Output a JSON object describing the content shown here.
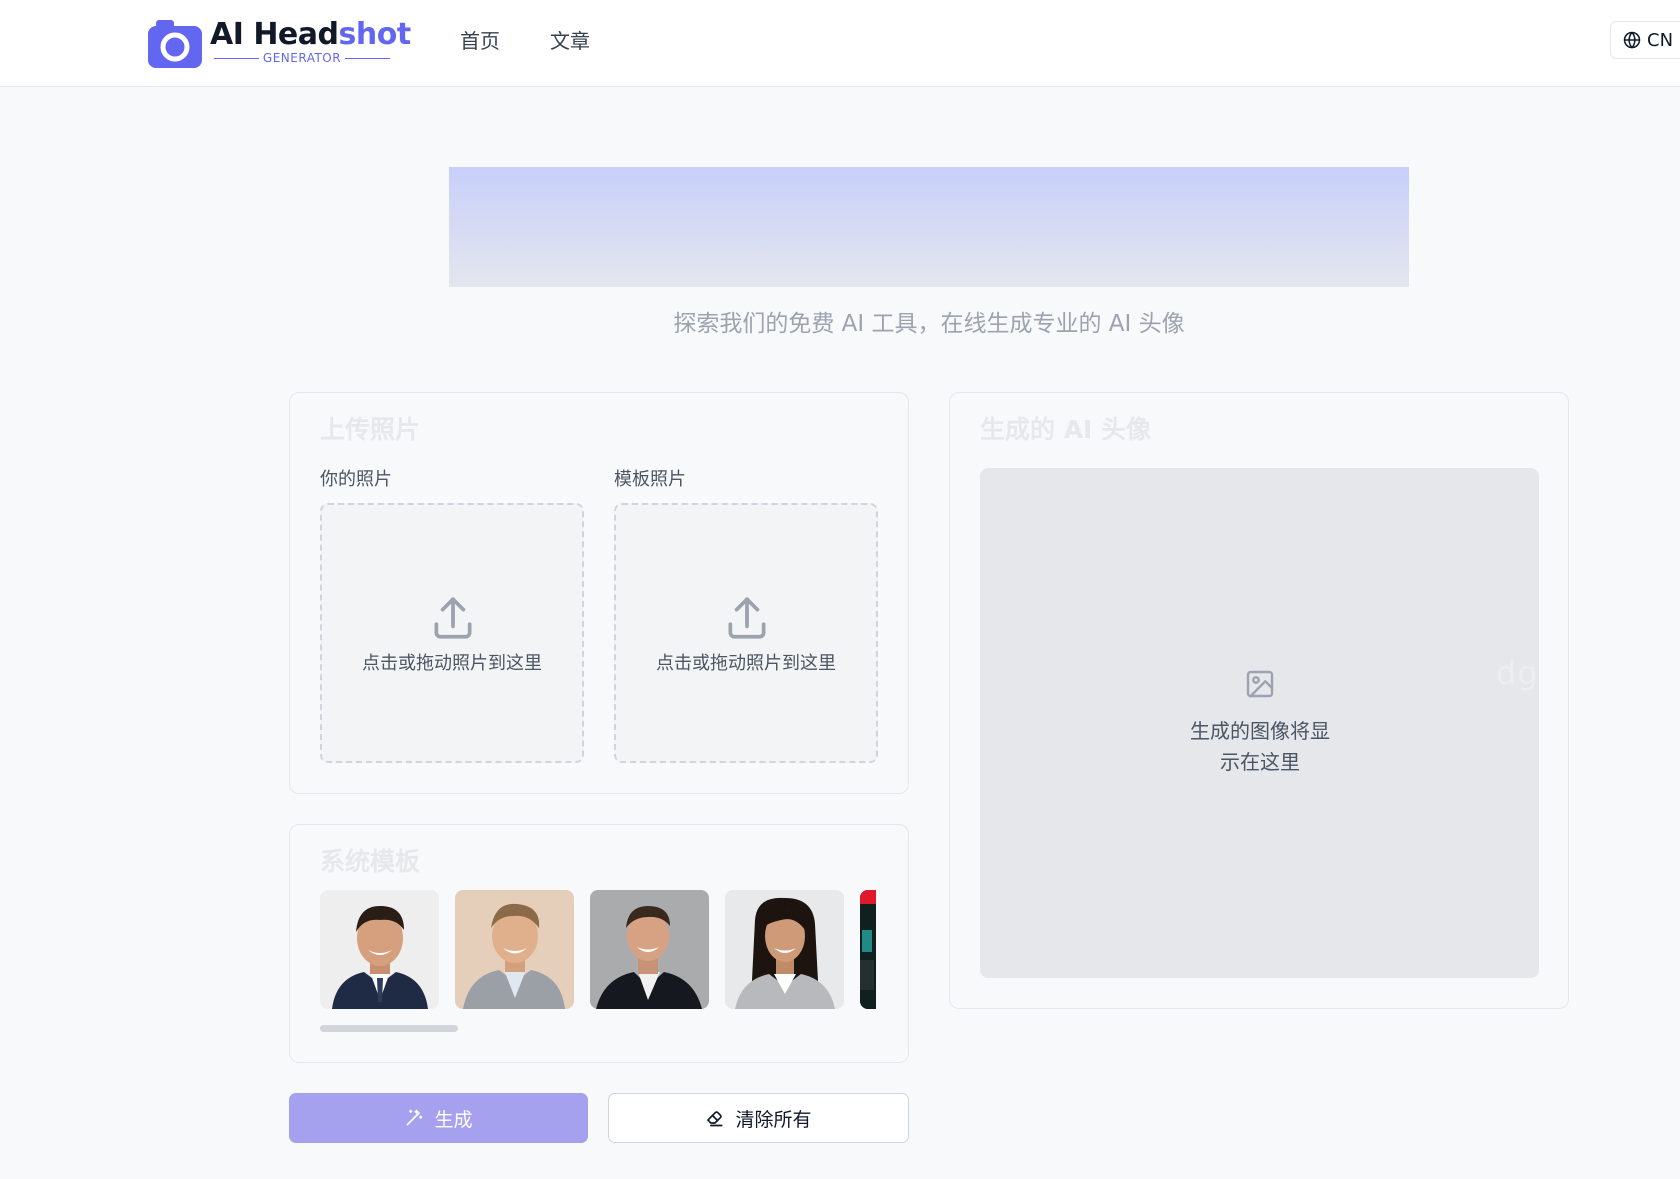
{
  "header": {
    "logo_ai": "AI Head",
    "logo_shot": "shot",
    "logo_sub": "GENERATOR",
    "nav": [
      {
        "label": "首页"
      },
      {
        "label": "文章"
      }
    ],
    "lang_label": "CN"
  },
  "hero": {
    "subtitle": "探索我们的免费 AI 工具，在线生成专业的 AI 头像"
  },
  "upload": {
    "title": "上传照片",
    "your_photo_label": "你的照片",
    "template_photo_label": "模板照片",
    "dropzone_text": "点击或拖动照片到这里"
  },
  "templates": {
    "title": "系统模板"
  },
  "result": {
    "title": "生成的 AI 头像",
    "placeholder_line1": "生成的图像将显",
    "placeholder_line2": "示在这里"
  },
  "actions": {
    "generate_label": "生成",
    "clear_label": "清除所有"
  },
  "watermark": "dg",
  "colors": {
    "brand": "#6366f1",
    "generate_button": "#a5a1ee"
  }
}
